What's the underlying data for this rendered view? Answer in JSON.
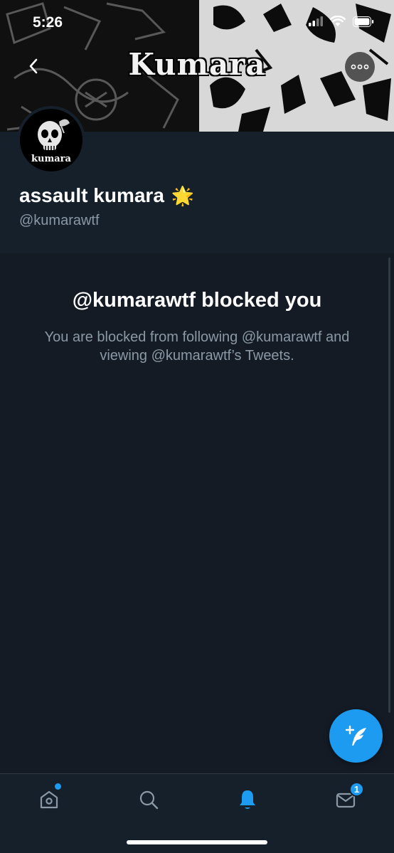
{
  "status_bar": {
    "time": "5:26"
  },
  "banner": {
    "title": "Kumara"
  },
  "avatar": {
    "label": "kumara"
  },
  "profile": {
    "display_name": "assault kumara",
    "emoji": "🌟",
    "handle": "@kumarawtf"
  },
  "blocked": {
    "title": "@kumarawtf blocked you",
    "message": "You are blocked from following @kumarawtf and viewing @kumarawtf’s Tweets."
  },
  "tabbar": {
    "items": [
      {
        "icon": "home-icon"
      },
      {
        "icon": "search-icon"
      },
      {
        "icon": "bell-icon"
      },
      {
        "icon": "mail-icon"
      }
    ],
    "messages_badge": "1"
  },
  "colors": {
    "accent": "#1d9bf0",
    "background": "#15202b",
    "secondary_text": "#8b98a5"
  }
}
